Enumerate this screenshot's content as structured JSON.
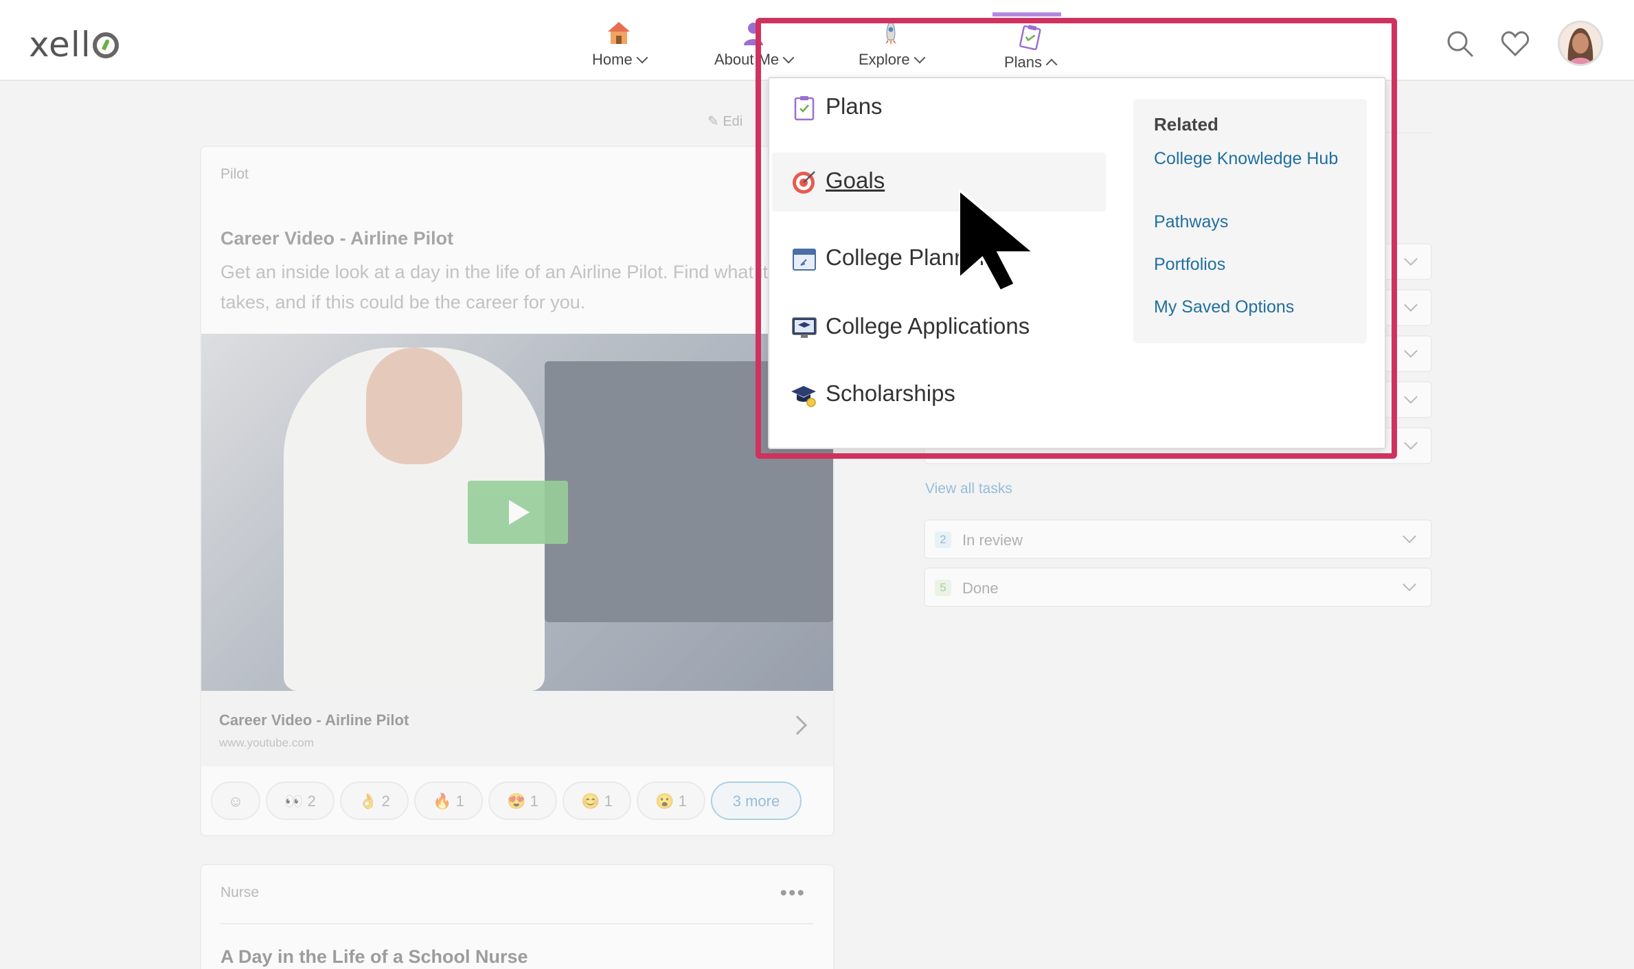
{
  "header": {
    "logo_text": "xell",
    "nav": [
      {
        "label": "Home",
        "icon": "house-icon"
      },
      {
        "label": "About Me",
        "icon": "person-icon"
      },
      {
        "label": "Explore",
        "icon": "rocket-icon"
      },
      {
        "label": "Plans",
        "icon": "clipboard-icon"
      }
    ],
    "icons": [
      "search-icon",
      "heart-icon",
      "avatar"
    ]
  },
  "background": {
    "edit_label": "Edi",
    "card1": {
      "tag": "Pilot",
      "title": "Career Video - Airline Pilot",
      "description": "Get an inside look at a day in the life of an Airline Pilot. Find what it takes, and if this could be the career for you.",
      "video_title": "Career Video - Airline Pilot",
      "video_url": "www.youtube.com",
      "reactions": [
        {
          "emoji": "👀",
          "count": "2"
        },
        {
          "emoji": "👌",
          "count": "2"
        },
        {
          "emoji": "🔥",
          "count": "1"
        },
        {
          "emoji": "😍",
          "count": "1"
        },
        {
          "emoji": "😊",
          "count": "1"
        },
        {
          "emoji": "😮",
          "count": "1"
        }
      ],
      "more_label": "3 more"
    },
    "card2": {
      "tag": "Nurse",
      "dots": "•••",
      "title": "A Day in the Life of a School Nurse"
    },
    "tasks": {
      "view_all": "View all tasks",
      "statuses": [
        {
          "count": "2",
          "label": "In review",
          "color": "#4a90c2"
        },
        {
          "count": "5",
          "label": "Done",
          "color": "#6ab04c"
        }
      ]
    }
  },
  "dropdown": {
    "items": [
      {
        "label": "Plans",
        "icon": "clipboard-icon"
      },
      {
        "label": "Goals",
        "icon": "target-icon"
      },
      {
        "label": "College Planning",
        "icon": "calendar-icon"
      },
      {
        "label": "College Applications",
        "icon": "monitor-icon"
      },
      {
        "label": "Scholarships",
        "icon": "grad-cap-icon"
      }
    ],
    "related": {
      "heading": "Related",
      "links": [
        "College Knowledge Hub",
        "Pathways",
        "Portfolios",
        "My Saved Options"
      ]
    }
  },
  "colors": {
    "highlight": "#d0325f",
    "link": "#1f6f9f",
    "accent_purple": "#b48ae0",
    "play_green": "#4caf50"
  }
}
